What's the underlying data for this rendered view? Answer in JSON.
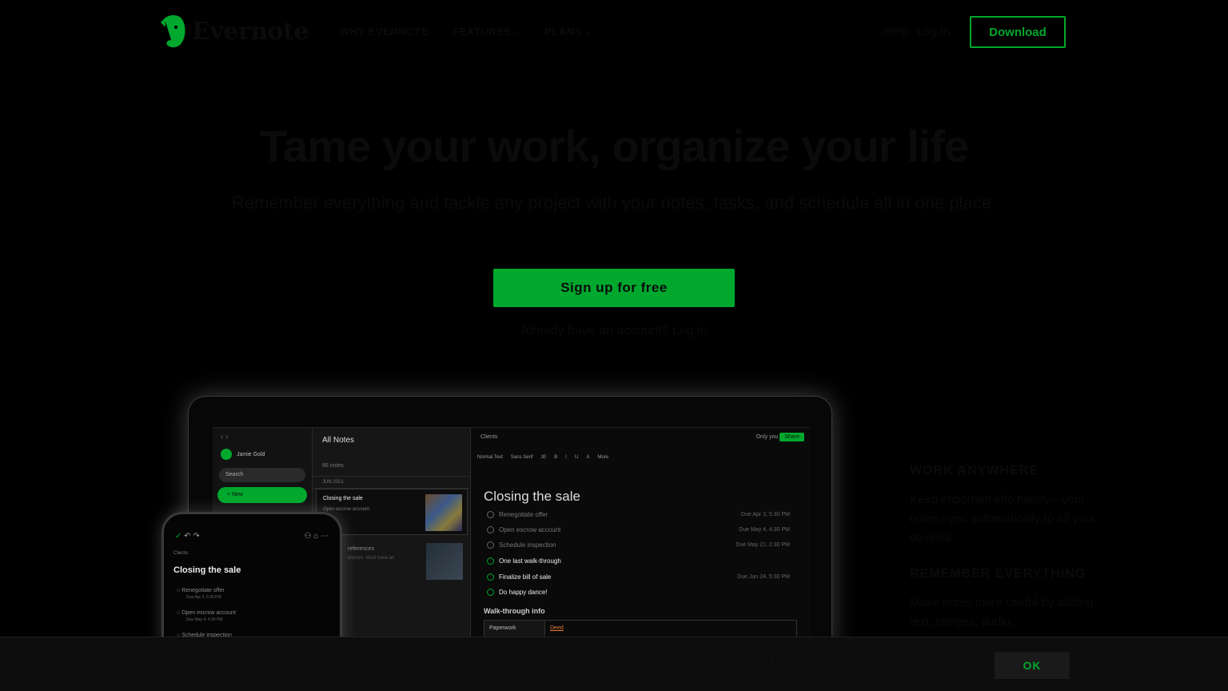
{
  "header": {
    "brand": "Evernote",
    "nav": [
      {
        "label": "WHY EVERNOTE",
        "dropdown": false
      },
      {
        "label": "FEATURES",
        "dropdown": true
      },
      {
        "label": "PLANS",
        "dropdown": true
      }
    ],
    "help": "Help",
    "login": "Log In",
    "download": "Download"
  },
  "hero": {
    "title": "Tame your work, organize your life",
    "subtitle": "Remember everything and tackle any project with your notes, tasks, and schedule all in one place.",
    "signup": "Sign up for free",
    "login_prompt": "Already have an account?",
    "login_link": "Log in"
  },
  "app_preview": {
    "sidebar": {
      "user": "Jamie Gold",
      "search": "Search",
      "new": "+ New"
    },
    "note_list": {
      "title": "All Notes",
      "count": "86 notes",
      "date_group": "JUN 2021",
      "card_title": "Closing the sale",
      "card_sub": "Open escrow account",
      "card2_title": "references",
      "card2_sub": "kitchen. Must have an"
    },
    "editor": {
      "crumb": "Clients",
      "only_you": "Only you",
      "share": "Share",
      "toolbar": [
        "Normal Text",
        "Sans Serif",
        "30",
        "B",
        "I",
        "U",
        "A",
        "More"
      ],
      "title": "Closing the sale",
      "tasks": [
        {
          "label": "Renegotiate offer",
          "due": "Due Apr 3, 5:30 PM",
          "active": false
        },
        {
          "label": "Open escrow account",
          "due": "Due May 4, 4:30 PM",
          "active": false
        },
        {
          "label": "Schedule inspection",
          "due": "Due May 21, 2:30 PM",
          "active": false
        },
        {
          "label": "One last walk-through",
          "due": "",
          "active": true
        },
        {
          "label": "Finalize bill of sale",
          "due": "Due Jun 24, 5:30 PM",
          "active": true
        },
        {
          "label": "Do happy dance!",
          "due": "",
          "active": true
        }
      ],
      "section": "Walk-through info",
      "table_label": "Paperwork",
      "table_value": "Deed"
    },
    "phone": {
      "crumb": "Clients",
      "title": "Closing the sale",
      "tasks": [
        {
          "label": "Renegotiate offer",
          "due": "Due Apr 3, 5:30 PM"
        },
        {
          "label": "Open escrow account",
          "due": "Due May 4, 4:30 PM"
        },
        {
          "label": "Schedule inspection",
          "due": ""
        }
      ]
    }
  },
  "features": [
    {
      "heading": "WORK ANYWHERE",
      "text": "Keep important info handy—your notes sync automatically to all your devices."
    },
    {
      "heading": "REMEMBER EVERYTHING",
      "text": "Make notes more useful by adding text, images, audio,"
    }
  ],
  "cookie_banner": {
    "text_before": "Evernote uses cookies to enable the Evernote service and to improve your experience with us. To learn more, check out our",
    "link": "cookie policy",
    "text_after": ". By clicking OK or continuing to use our site, you agree that we can place these cookies.",
    "ok": "OK"
  },
  "colors": {
    "brand_green": "#00a82d",
    "background": "#000000"
  }
}
